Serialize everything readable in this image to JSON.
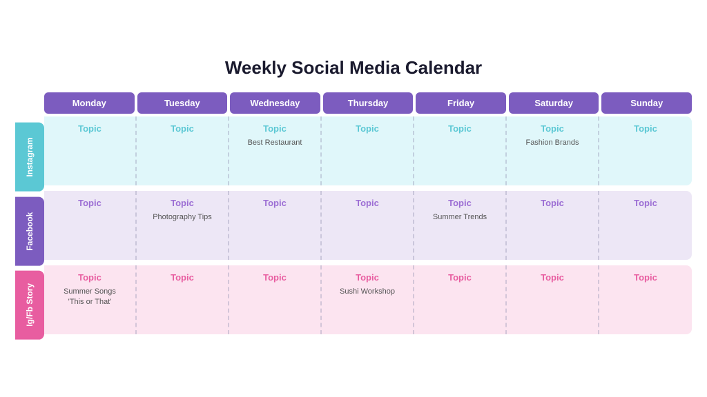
{
  "title": "Weekly Social Media Calendar",
  "days": [
    "Monday",
    "Tuesday",
    "Wednesday",
    "Thursday",
    "Friday",
    "Saturday",
    "Sunday"
  ],
  "rows": [
    {
      "label": "Instagram",
      "class": "instagram",
      "rowClass": "instagram-row",
      "cells": [
        {
          "topic": "Topic",
          "content": ""
        },
        {
          "topic": "Topic",
          "content": ""
        },
        {
          "topic": "Topic",
          "content": "Best Restaurant"
        },
        {
          "topic": "Topic",
          "content": ""
        },
        {
          "topic": "Topic",
          "content": ""
        },
        {
          "topic": "Topic",
          "content": "Fashion Brands"
        },
        {
          "topic": "Topic",
          "content": ""
        }
      ]
    },
    {
      "label": "Facebook",
      "class": "facebook",
      "rowClass": "facebook-row",
      "cells": [
        {
          "topic": "Topic",
          "content": ""
        },
        {
          "topic": "Topic",
          "content": "Photography Tips"
        },
        {
          "topic": "Topic",
          "content": ""
        },
        {
          "topic": "Topic",
          "content": ""
        },
        {
          "topic": "Topic",
          "content": "Summer Trends"
        },
        {
          "topic": "Topic",
          "content": ""
        },
        {
          "topic": "Topic",
          "content": ""
        }
      ]
    },
    {
      "label": "Ig/Fb Story",
      "class": "igfbstory",
      "rowClass": "story-row",
      "cells": [
        {
          "topic": "Topic",
          "content": "Summer Songs\n'This or That'"
        },
        {
          "topic": "Topic",
          "content": ""
        },
        {
          "topic": "Topic",
          "content": ""
        },
        {
          "topic": "Topic",
          "content": "Sushi Workshop"
        },
        {
          "topic": "Topic",
          "content": ""
        },
        {
          "topic": "Topic",
          "content": ""
        },
        {
          "topic": "Topic",
          "content": ""
        }
      ]
    }
  ]
}
